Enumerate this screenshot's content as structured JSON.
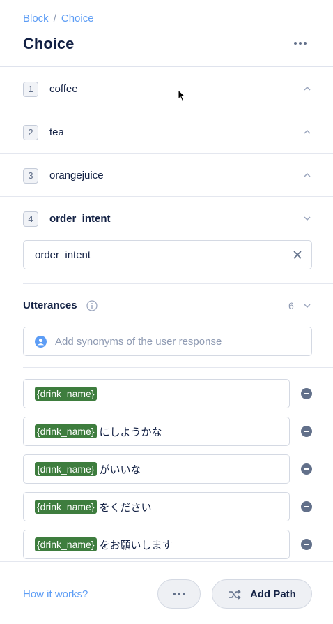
{
  "breadcrumb": {
    "root": "Block",
    "separator": "/",
    "current": "Choice"
  },
  "header": {
    "title": "Choice",
    "menu_icon": "more-dots-icon"
  },
  "paths": [
    {
      "number": "1",
      "label": "coffee",
      "expanded": false
    },
    {
      "number": "2",
      "label": "tea",
      "expanded": false
    },
    {
      "number": "3",
      "label": "orangejuice",
      "expanded": false
    },
    {
      "number": "4",
      "label": "order_intent",
      "expanded": true
    }
  ],
  "intent": {
    "value": "order_intent"
  },
  "utterances": {
    "title": "Utterances",
    "count": "6",
    "placeholder": "Add synonyms of the user response",
    "items": [
      {
        "slot": "{drink_name}",
        "text": ""
      },
      {
        "slot": "{drink_name}",
        "text": "にしようかな"
      },
      {
        "slot": "{drink_name}",
        "text": "がいいな"
      },
      {
        "slot": "{drink_name}",
        "text": "をください"
      },
      {
        "slot": "{drink_name}",
        "text": "をお願いします"
      }
    ]
  },
  "footer": {
    "help_link": "How it works?",
    "add_path_label": "Add Path"
  },
  "colors": {
    "accent": "#5d9df5",
    "slot": "#3e7d3e",
    "text": "#132144",
    "muted": "#8f9bb3"
  }
}
